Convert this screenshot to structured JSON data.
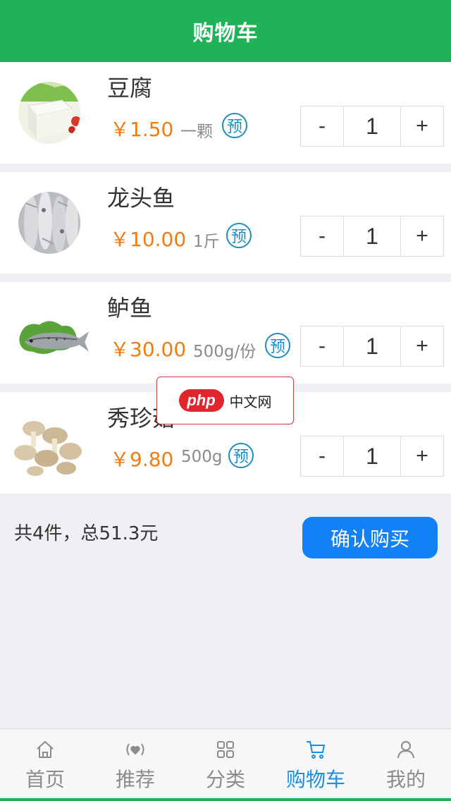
{
  "header": {
    "title": "购物车"
  },
  "cart": {
    "items": [
      {
        "name": "豆腐",
        "price": "￥1.50",
        "unit": "一颗",
        "badge": "预",
        "quantity": "1",
        "minus": "-",
        "plus": "+",
        "image_icon": "tofu-image"
      },
      {
        "name": "龙头鱼",
        "price": "￥10.00",
        "unit": "1斤",
        "badge": "预",
        "quantity": "1",
        "minus": "-",
        "plus": "+",
        "image_icon": "bombay-duck-image"
      },
      {
        "name": "鲈鱼",
        "price": "￥30.00",
        "unit": "500g/份",
        "badge": "预",
        "quantity": "1",
        "minus": "-",
        "plus": "+",
        "image_icon": "sea-bass-image"
      },
      {
        "name": "秀珍菇",
        "price": "￥9.80",
        "unit": "500g",
        "badge": "预",
        "quantity": "1",
        "minus": "-",
        "plus": "+",
        "image_icon": "oyster-mushroom-image"
      }
    ]
  },
  "summary": {
    "text": "共4件，总51.3元"
  },
  "confirm_button": {
    "label": "确认购买"
  },
  "watermark": {
    "logo": "php",
    "text": "中文网"
  },
  "tabbar": {
    "tabs": [
      {
        "label": "首页",
        "icon": "home-icon",
        "active": false
      },
      {
        "label": "推荐",
        "icon": "recommend-icon",
        "active": false
      },
      {
        "label": "分类",
        "icon": "category-icon",
        "active": false
      },
      {
        "label": "购物车",
        "icon": "cart-icon",
        "active": true
      },
      {
        "label": "我的",
        "icon": "user-icon",
        "active": false
      }
    ]
  },
  "colors": {
    "header_bg": "#1fb257",
    "price": "#f07c12",
    "badge": "#1a8ec2",
    "confirm_bg": "#1281f5",
    "tab_active": "#1a8ee0",
    "page_bg": "#efeff4"
  }
}
